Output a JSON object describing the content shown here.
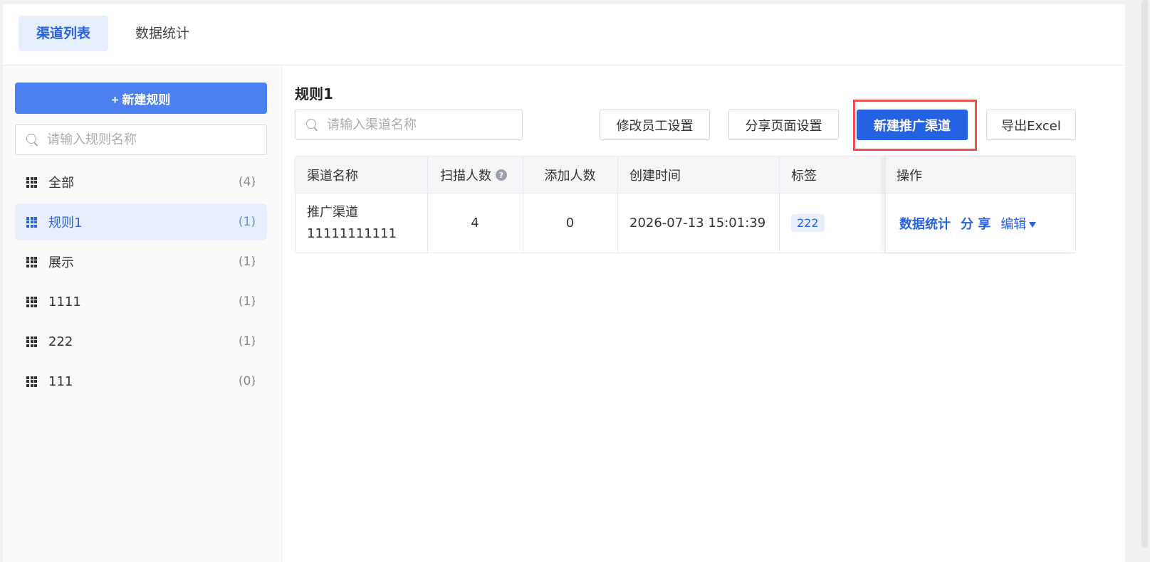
{
  "tabs": [
    {
      "label": "渠道列表",
      "active": true
    },
    {
      "label": "数据统计",
      "active": false
    }
  ],
  "sidebar": {
    "new_rule_label": "+ 新建规则",
    "search_placeholder": "请输入规则名称",
    "rules": [
      {
        "name": "全部",
        "count": "(4)",
        "active": false
      },
      {
        "name": "规则1",
        "count": "(1)",
        "active": true
      },
      {
        "name": "展示",
        "count": "(1)",
        "active": false
      },
      {
        "name": "1111",
        "count": "(1)",
        "active": false
      },
      {
        "name": "222",
        "count": "(1)",
        "active": false
      },
      {
        "name": "111",
        "count": "(0)",
        "active": false
      }
    ]
  },
  "main": {
    "title": "规则1",
    "search_placeholder": "请输入渠道名称",
    "buttons": {
      "staff_settings": "修改员工设置",
      "share_settings": "分享页面设置",
      "new_channel": "新建推广渠道",
      "export": "导出Excel"
    },
    "table": {
      "headers": {
        "name": "渠道名称",
        "scan": "扫描人数",
        "add": "添加人数",
        "created": "创建时间",
        "tag": "标签",
        "ops": "操作"
      },
      "help_glyph": "?",
      "rows": [
        {
          "name_line1": "推广渠道",
          "name_line2": "11111111111",
          "scan": "4",
          "add": "0",
          "created": "2026-07-13 15:01:39",
          "tag": "222",
          "ops": {
            "stats": "数据统计",
            "share": "分 享",
            "edit": "编辑"
          }
        }
      ]
    }
  },
  "colors": {
    "primary": "#2561e3",
    "accent_light": "#e8effc",
    "highlight_box": "#e9524e"
  }
}
